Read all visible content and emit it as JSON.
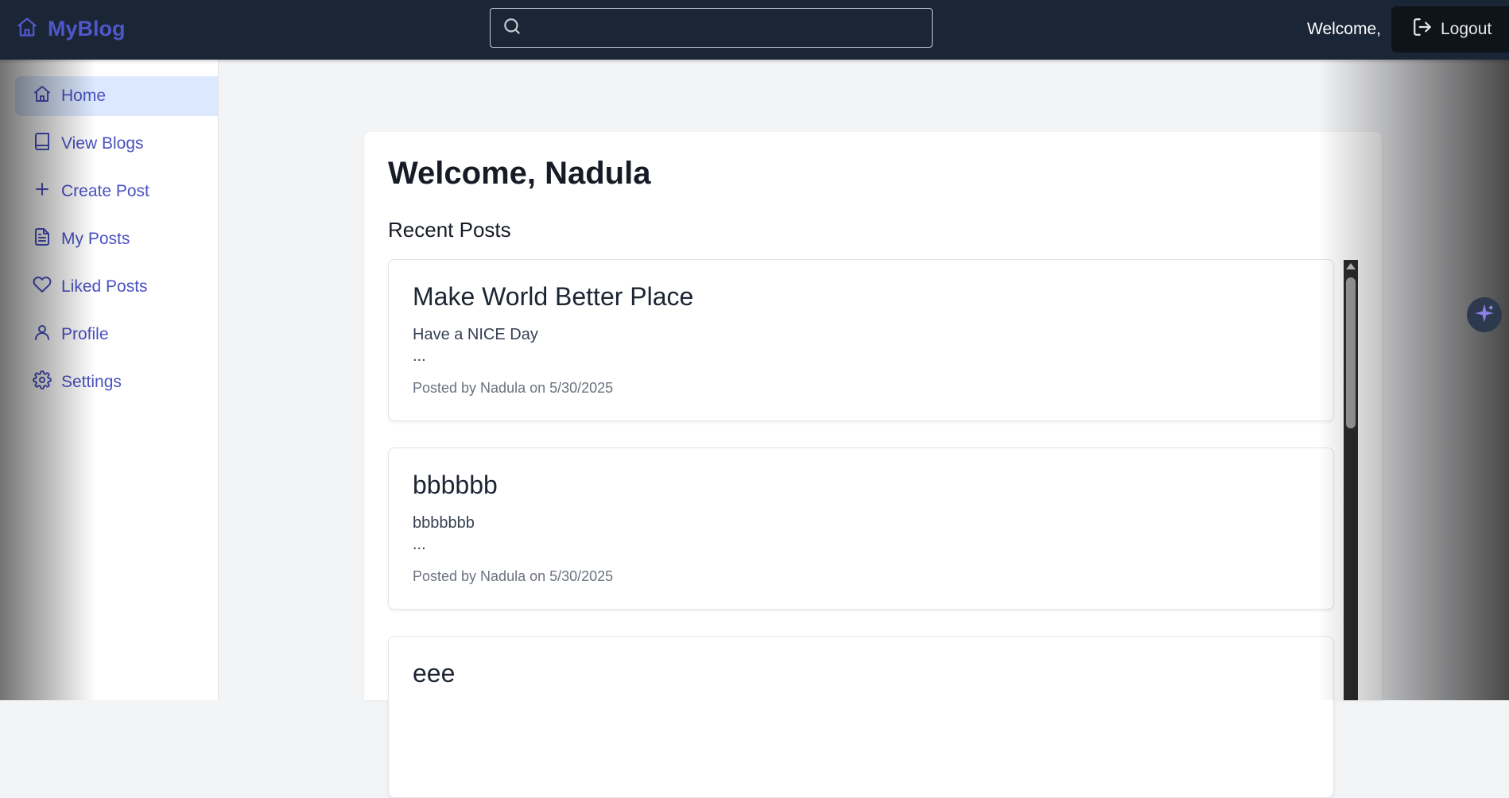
{
  "header": {
    "brand": "MyBlog",
    "search_placeholder": "",
    "welcome_text": "Welcome,",
    "logout_label": "Logout"
  },
  "sidebar": {
    "items": [
      {
        "label": "Home",
        "icon": "home-icon",
        "active": true
      },
      {
        "label": "View Blogs",
        "icon": "book-icon"
      },
      {
        "label": "Create Post",
        "icon": "plus-icon"
      },
      {
        "label": "My Posts",
        "icon": "document-icon"
      },
      {
        "label": "Liked Posts",
        "icon": "heart-icon"
      },
      {
        "label": "Profile",
        "icon": "user-icon"
      },
      {
        "label": "Settings",
        "icon": "gear-icon"
      }
    ]
  },
  "main": {
    "title": "Welcome, Nadula",
    "section_title": "Recent Posts",
    "posts": [
      {
        "title": "Make World Better Place",
        "excerpt": "Have a NICE Day",
        "ellipsis": "...",
        "meta": "Posted by Nadula on 5/30/2025"
      },
      {
        "title": "bbbbbb",
        "excerpt": "bbbbbbb",
        "ellipsis": "...",
        "meta": "Posted by Nadula on 5/30/2025"
      },
      {
        "title": "eee",
        "excerpt": "",
        "ellipsis": "",
        "meta": ""
      }
    ]
  },
  "colors": {
    "topbar_bg": "#1a2536",
    "brand": "#4f57c9",
    "nav_text": "#4a52c1",
    "nav_active_bg": "#dbe8fe",
    "page_bg": "#f3f4f6"
  }
}
